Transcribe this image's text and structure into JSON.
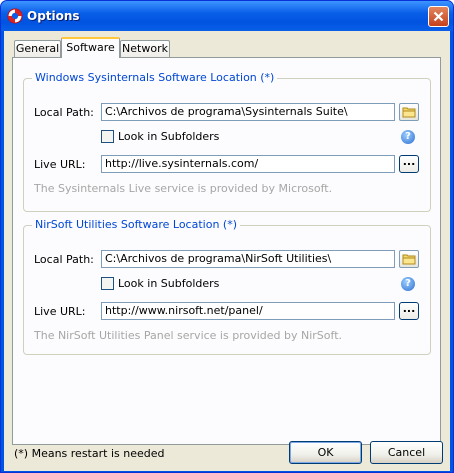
{
  "window": {
    "title": "Options",
    "close_label": "✕"
  },
  "tabs": [
    {
      "label": "General",
      "active": false
    },
    {
      "label": "Software",
      "active": true
    },
    {
      "label": "Network",
      "active": false
    }
  ],
  "sysinternals": {
    "group_title": "Windows Sysinternals Software Location (*)",
    "local_path_label": "Local Path:",
    "local_path_value": "C:\\Archivos de programa\\Sysinternals Suite\\",
    "subfolders_label": "Look in Subfolders",
    "subfolders_checked": false,
    "live_url_label": "Live URL:",
    "live_url_value": "http://live.sysinternals.com/",
    "browse_label": "...",
    "note": "The Sysinternals Live service is provided by Microsoft."
  },
  "nirsoft": {
    "group_title": "NirSoft Utilities Software Location (*)",
    "local_path_label": "Local Path:",
    "local_path_value": "C:\\Archivos de programa\\NirSoft Utilities\\",
    "subfolders_label": "Look in Subfolders",
    "subfolders_checked": false,
    "live_url_label": "Live URL:",
    "live_url_value": "http://www.nirsoft.net/panel/",
    "browse_label": "...",
    "note": "The NirSoft Utilities Panel service is provided by NirSoft."
  },
  "footer": {
    "restart_note": "(*) Means restart is needed",
    "ok_label": "OK",
    "cancel_label": "Cancel"
  },
  "icons": {
    "app": "lifebuoy-icon",
    "folder": "folder-icon",
    "help": "help-icon"
  },
  "help_glyph": "?",
  "colors": {
    "titlebar": "#0a5fe8",
    "group_title": "#0046d5",
    "active_tab_accent": "#ffc83c",
    "note_text": "#a6a6a6"
  }
}
